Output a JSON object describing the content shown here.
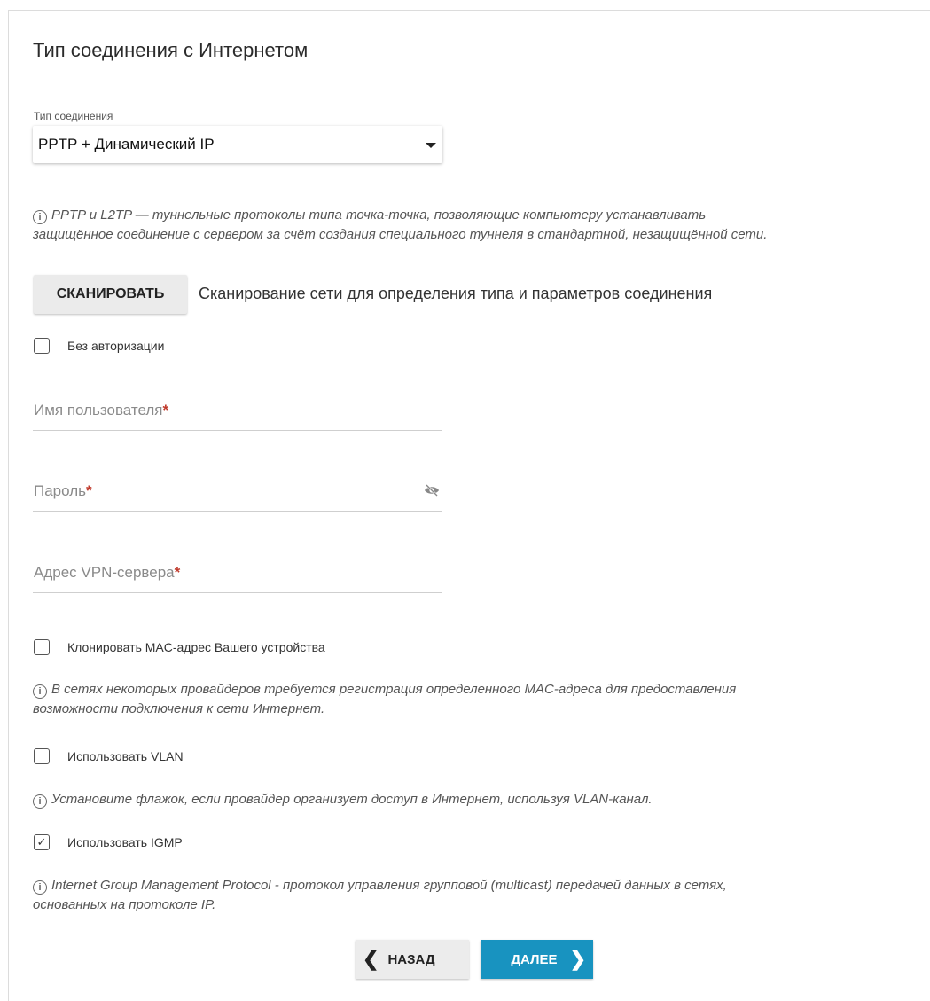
{
  "title": "Тип соединения с Интернетом",
  "connection": {
    "label": "Тип соединения",
    "selected": "PPTP + Динамический IP"
  },
  "info_pptp": {
    "line1": "PPTP и L2TP — туннельные протоколы типа точка-точка, позволяющие компьютеру устанавливать",
    "line2": "защищённое соединение с сервером за счёт создания специального туннеля в стандартной, незащищённой сети."
  },
  "scan": {
    "button": "СКАНИРОВАТЬ",
    "description": "Сканирование сети для определения типа и параметров соединения"
  },
  "no_auth": {
    "label": "Без авторизации",
    "checked": false
  },
  "fields": {
    "username": "Имя пользователя",
    "password": "Пароль",
    "vpn_server": "Адрес VPN-сервера",
    "required_mark": "*"
  },
  "clone_mac": {
    "label": "Клонировать MAC-адрес Вашего устройства",
    "checked": false,
    "info_line1": "В сетях некоторых провайдеров требуется регистрация определенного MAC-адреса для предоставления",
    "info_line2": "возможности подключения к сети Интернет."
  },
  "vlan": {
    "label": "Использовать VLAN",
    "checked": false,
    "info": "Установите флажок, если провайдер организует доступ в Интернет, используя VLAN-канал."
  },
  "igmp": {
    "label": "Использовать IGMP",
    "checked": true,
    "info_line1": "Internet Group Management Protocol - протокол управления групповой (multicast) передачей данных в сетях,",
    "info_line2": "основанных на протоколе IP."
  },
  "nav": {
    "back": "НАЗАД",
    "next": "ДАЛЕЕ"
  },
  "icons": {
    "info": "info-icon",
    "eye_off": "eye-off-icon",
    "check": "check-icon"
  },
  "colors": {
    "accent": "#1893c0",
    "required": "#c0392b"
  }
}
